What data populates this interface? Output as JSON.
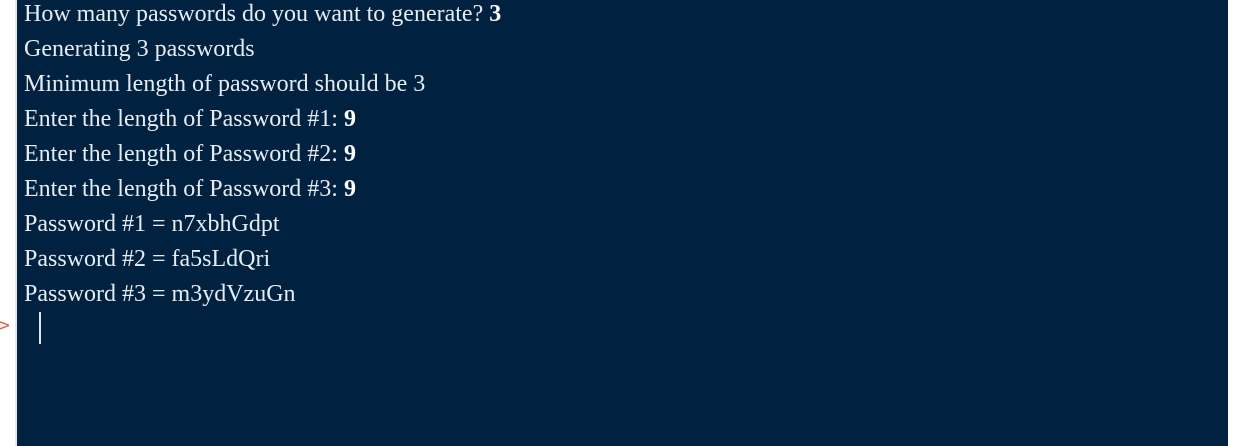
{
  "console": {
    "lines": [
      {
        "text": "How many passwords do you want to generate? ",
        "input": "3"
      },
      {
        "text": "Generating 3 passwords",
        "input": ""
      },
      {
        "text": "Minimum length of password should be 3",
        "input": ""
      },
      {
        "text": "Enter the length of Password #1: ",
        "input": "9"
      },
      {
        "text": "Enter the length of Password #2: ",
        "input": "9"
      },
      {
        "text": "Enter the length of Password #3: ",
        "input": "9"
      },
      {
        "text": "Password #1 = n7xbhGdpt",
        "input": ""
      },
      {
        "text": "Password #2 = fa5sLdQri",
        "input": ""
      },
      {
        "text": "Password #3 = m3ydVzuGn",
        "input": ""
      }
    ],
    "prompt_symbol": ">",
    "colors": {
      "background": "#002240",
      "text": "#e6ecf2",
      "prompt": "#e05a4a"
    }
  }
}
